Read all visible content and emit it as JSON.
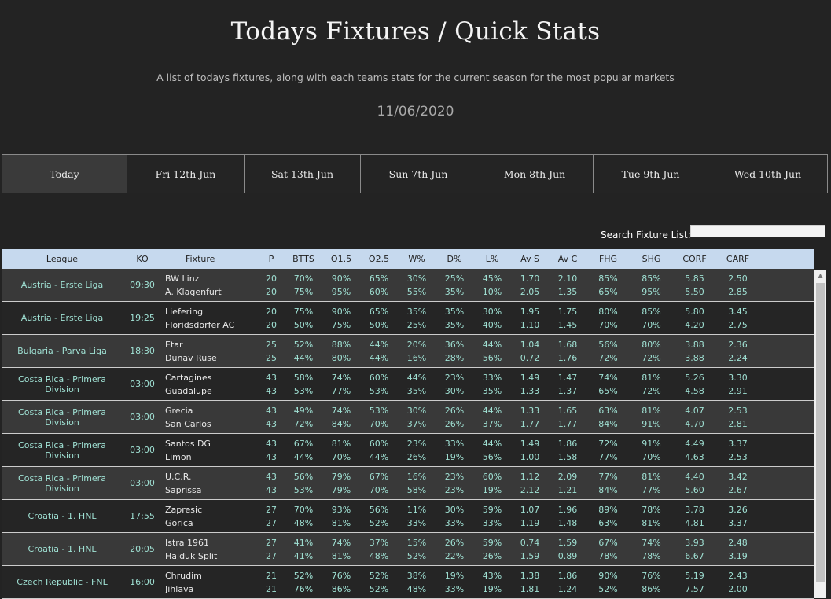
{
  "header": {
    "title": "Todays Fixtures / Quick Stats",
    "subtitle": "A list of todays fixtures, along with each teams stats for the current season for the most popular markets",
    "date": "11/06/2020"
  },
  "tabs": [
    {
      "label": "Today",
      "active": true
    },
    {
      "label": "Fri 12th Jun",
      "active": false
    },
    {
      "label": "Sat 13th Jun",
      "active": false
    },
    {
      "label": "Sun 7th Jun",
      "active": false
    },
    {
      "label": "Mon 8th Jun",
      "active": false
    },
    {
      "label": "Tue 9th Jun",
      "active": false
    },
    {
      "label": "Wed 10th Jun",
      "active": false
    }
  ],
  "search": {
    "label": "Search Fixture List:",
    "value": ""
  },
  "columns": [
    "League",
    "KO",
    "Fixture",
    "P",
    "BTTS",
    "O1.5",
    "O2.5",
    "W%",
    "D%",
    "L%",
    "Av S",
    "Av C",
    "FHG",
    "SHG",
    "CORF",
    "CARF"
  ],
  "colors": {
    "accent": "#9fe0d3",
    "header_bg": "#c6d9ee",
    "row_odd": "#393939",
    "row_even": "#252525"
  },
  "fixtures": [
    {
      "league": "Austria - Erste Liga",
      "ko": "09:30",
      "teams": [
        [
          "BW Linz",
          "20",
          "70%",
          "90%",
          "65%",
          "30%",
          "25%",
          "45%",
          "1.70",
          "2.10",
          "85%",
          "85%",
          "5.85",
          "2.50"
        ],
        [
          "A. Klagenfurt",
          "20",
          "75%",
          "95%",
          "60%",
          "55%",
          "35%",
          "10%",
          "2.05",
          "1.35",
          "65%",
          "95%",
          "5.50",
          "2.85"
        ]
      ]
    },
    {
      "league": "Austria - Erste Liga",
      "ko": "19:25",
      "teams": [
        [
          "Liefering",
          "20",
          "75%",
          "90%",
          "65%",
          "35%",
          "35%",
          "30%",
          "1.95",
          "1.75",
          "80%",
          "85%",
          "5.80",
          "3.45"
        ],
        [
          "Floridsdorfer AC",
          "20",
          "50%",
          "75%",
          "50%",
          "25%",
          "35%",
          "40%",
          "1.10",
          "1.45",
          "70%",
          "70%",
          "4.20",
          "2.75"
        ]
      ]
    },
    {
      "league": "Bulgaria - Parva Liga",
      "ko": "18:30",
      "teams": [
        [
          "Etar",
          "25",
          "52%",
          "88%",
          "44%",
          "20%",
          "36%",
          "44%",
          "1.04",
          "1.68",
          "56%",
          "80%",
          "3.88",
          "2.36"
        ],
        [
          "Dunav Ruse",
          "25",
          "44%",
          "80%",
          "44%",
          "16%",
          "28%",
          "56%",
          "0.72",
          "1.76",
          "72%",
          "72%",
          "3.88",
          "2.24"
        ]
      ]
    },
    {
      "league": "Costa Rica - Primera Division",
      "ko": "03:00",
      "teams": [
        [
          "Cartagines",
          "43",
          "58%",
          "74%",
          "60%",
          "44%",
          "23%",
          "33%",
          "1.49",
          "1.47",
          "74%",
          "81%",
          "5.26",
          "3.30"
        ],
        [
          "Guadalupe",
          "43",
          "53%",
          "77%",
          "53%",
          "35%",
          "30%",
          "35%",
          "1.33",
          "1.37",
          "65%",
          "72%",
          "4.58",
          "2.91"
        ]
      ]
    },
    {
      "league": "Costa Rica - Primera Division",
      "ko": "03:00",
      "teams": [
        [
          "Grecia",
          "43",
          "49%",
          "74%",
          "53%",
          "30%",
          "26%",
          "44%",
          "1.33",
          "1.65",
          "63%",
          "81%",
          "4.07",
          "2.53"
        ],
        [
          "San Carlos",
          "43",
          "72%",
          "84%",
          "70%",
          "37%",
          "26%",
          "37%",
          "1.77",
          "1.77",
          "84%",
          "91%",
          "4.70",
          "2.81"
        ]
      ]
    },
    {
      "league": "Costa Rica - Primera Division",
      "ko": "03:00",
      "teams": [
        [
          "Santos DG",
          "43",
          "67%",
          "81%",
          "60%",
          "23%",
          "33%",
          "44%",
          "1.49",
          "1.86",
          "72%",
          "91%",
          "4.49",
          "3.37"
        ],
        [
          "Limon",
          "43",
          "44%",
          "70%",
          "44%",
          "26%",
          "19%",
          "56%",
          "1.00",
          "1.58",
          "77%",
          "70%",
          "4.63",
          "2.53"
        ]
      ]
    },
    {
      "league": "Costa Rica - Primera Division",
      "ko": "03:00",
      "teams": [
        [
          "U.C.R.",
          "43",
          "56%",
          "79%",
          "67%",
          "16%",
          "23%",
          "60%",
          "1.12",
          "2.09",
          "77%",
          "81%",
          "4.40",
          "3.42"
        ],
        [
          "Saprissa",
          "43",
          "53%",
          "79%",
          "70%",
          "58%",
          "23%",
          "19%",
          "2.12",
          "1.21",
          "84%",
          "77%",
          "5.60",
          "2.67"
        ]
      ]
    },
    {
      "league": "Croatia - 1. HNL",
      "ko": "17:55",
      "teams": [
        [
          "Zapresic",
          "27",
          "70%",
          "93%",
          "56%",
          "11%",
          "30%",
          "59%",
          "1.07",
          "1.96",
          "89%",
          "78%",
          "3.78",
          "3.26"
        ],
        [
          "Gorica",
          "27",
          "48%",
          "81%",
          "52%",
          "33%",
          "33%",
          "33%",
          "1.19",
          "1.48",
          "63%",
          "81%",
          "4.81",
          "3.37"
        ]
      ]
    },
    {
      "league": "Croatia - 1. HNL",
      "ko": "20:05",
      "teams": [
        [
          "Istra 1961",
          "27",
          "41%",
          "74%",
          "37%",
          "15%",
          "26%",
          "59%",
          "0.74",
          "1.59",
          "67%",
          "74%",
          "3.93",
          "2.48"
        ],
        [
          "Hajduk Split",
          "27",
          "41%",
          "81%",
          "48%",
          "52%",
          "22%",
          "26%",
          "1.59",
          "0.89",
          "78%",
          "78%",
          "6.67",
          "3.19"
        ]
      ]
    },
    {
      "league": "Czech Republic - FNL",
      "ko": "16:00",
      "teams": [
        [
          "Chrudim",
          "21",
          "52%",
          "76%",
          "52%",
          "38%",
          "19%",
          "43%",
          "1.38",
          "1.86",
          "90%",
          "76%",
          "5.19",
          "2.43"
        ],
        [
          "Jihlava",
          "21",
          "76%",
          "86%",
          "52%",
          "48%",
          "33%",
          "19%",
          "1.81",
          "1.24",
          "52%",
          "86%",
          "7.57",
          "2.00"
        ]
      ]
    }
  ]
}
